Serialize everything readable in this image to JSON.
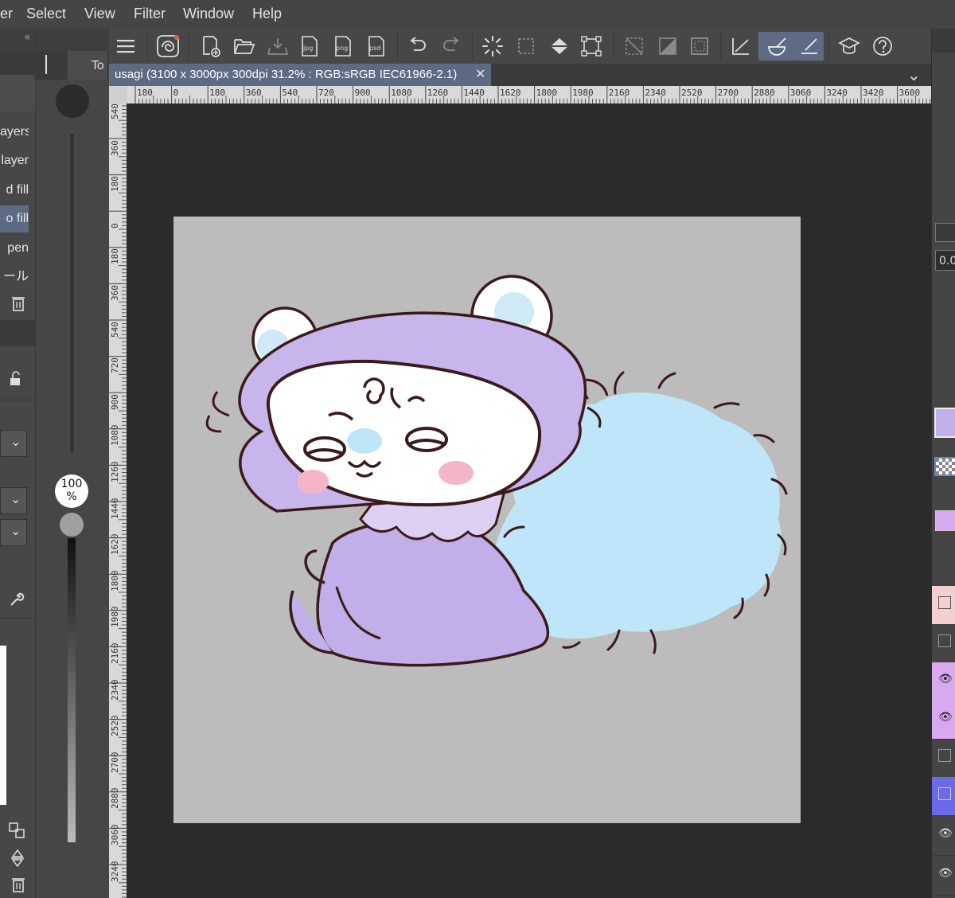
{
  "menu": {
    "items": [
      "er",
      "Select",
      "View",
      "Filter",
      "Window",
      "Help"
    ]
  },
  "left_panel": {
    "items": [
      "ayers",
      "layer",
      "d fill",
      "o fill",
      "pen",
      "ール"
    ]
  },
  "size_panel": {
    "tab_label": "To",
    "opacity_value": "100",
    "opacity_unit": "%"
  },
  "document_tab": {
    "title": "usagi (3100 x 3000px 300dpi 31.2% : RGB:sRGB IEC61966-2.1)"
  },
  "ruler": {
    "h_labels": [
      "180",
      "0",
      "180",
      "360",
      "540",
      "720",
      "900",
      "1080",
      "1260",
      "1440",
      "1620",
      "1800",
      "1980",
      "2160",
      "2340",
      "2520",
      "2700",
      "2880",
      "3060",
      "3240",
      "3420",
      "3600"
    ],
    "v_labels": [
      "540",
      "360",
      "180",
      "0",
      "180",
      "360",
      "540",
      "720",
      "900",
      "1080",
      "1260",
      "1440",
      "1620",
      "1800",
      "1980",
      "2160",
      "2340",
      "2520",
      "2700",
      "2880",
      "3060",
      "3240"
    ]
  },
  "right_panel": {
    "value_field": "0.0"
  },
  "colors": {
    "accent_active_tool": "#5e6b84",
    "paper": "#bcbcbc",
    "character_purple": "#c2aee8",
    "fluff_blue": "#bfe6f8",
    "line_brown": "#3a1a1a",
    "cheek_pink": "#f4b6c6"
  }
}
